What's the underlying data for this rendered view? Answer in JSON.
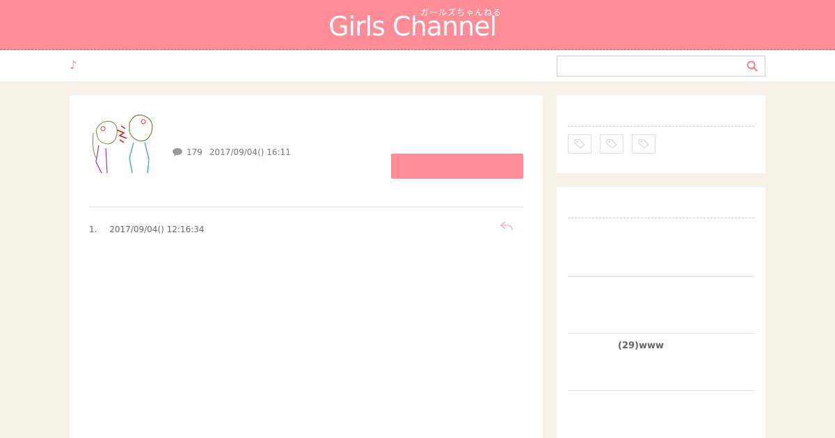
{
  "header": {
    "logo": "Girls Channel",
    "logo_sub": "ガールズちゃんねる",
    "note_glyph": "♪"
  },
  "search": {
    "placeholder": "",
    "value": ""
  },
  "topic": {
    "comment_count": "179",
    "posted_date": "2017/09/04() 16:11",
    "icon": "speech-bubble-icon"
  },
  "comments": [
    {
      "number": "1.",
      "date": "2017/09/04() 12:16:34"
    }
  ],
  "sidebar": {
    "ranking_item": "(29)www"
  },
  "colors": {
    "brand": "#ff8c96",
    "background": "#f8f1e8"
  }
}
